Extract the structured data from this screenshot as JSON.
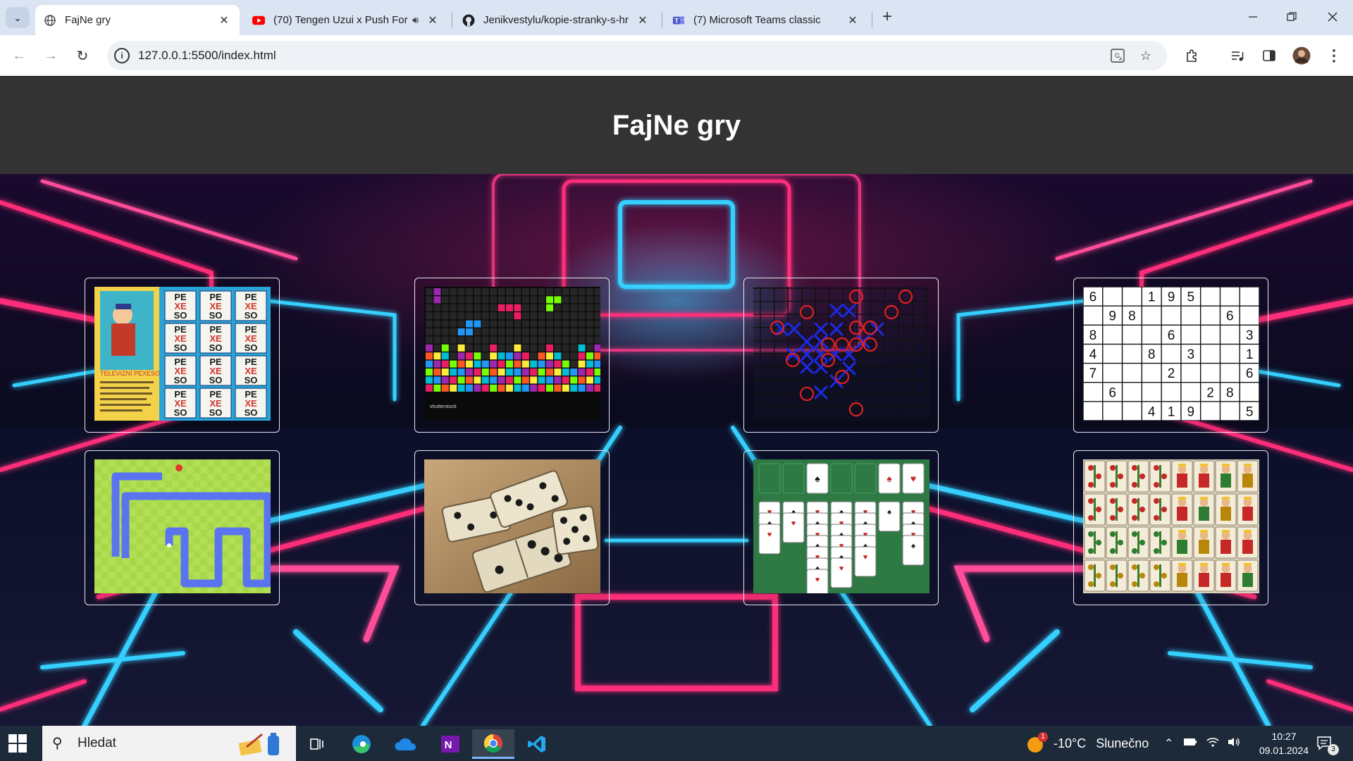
{
  "browser": {
    "tabs": [
      {
        "title": "FajNe gry",
        "active": true,
        "icon": "globe-icon"
      },
      {
        "title": "(70) Tengen Uzui x Push For",
        "active": false,
        "icon": "youtube-icon",
        "audio": true
      },
      {
        "title": "Jenikvestylu/kopie-stranky-s-hr",
        "active": false,
        "icon": "github-icon"
      },
      {
        "title": "(7) Microsoft Teams classic",
        "active": false,
        "icon": "teams-icon"
      }
    ],
    "url": "127.0.0.1:5500/index.html"
  },
  "page": {
    "title": "FajNe gry",
    "games": [
      {
        "name": "pexeso",
        "icon": "pexeso-thumbnail"
      },
      {
        "name": "tetris",
        "icon": "tetris-thumbnail"
      },
      {
        "name": "piskvorky",
        "icon": "tic-tac-toe-thumbnail"
      },
      {
        "name": "sudoku",
        "icon": "sudoku-thumbnail"
      },
      {
        "name": "snake",
        "icon": "snake-thumbnail"
      },
      {
        "name": "domino",
        "icon": "domino-thumbnail"
      },
      {
        "name": "solitaire",
        "icon": "solitaire-thumbnail"
      },
      {
        "name": "mariase",
        "icon": "card-deck-thumbnail"
      }
    ],
    "sudoku": [
      [
        "6",
        "",
        "",
        "1",
        "9",
        "5",
        "",
        "",
        ""
      ],
      [
        "",
        "9",
        "8",
        "",
        "",
        "",
        "",
        "6",
        ""
      ],
      [
        "8",
        "",
        "",
        "",
        "6",
        "",
        "",
        "",
        "3"
      ],
      [
        "4",
        "",
        "",
        "8",
        "",
        "3",
        "",
        "",
        "1"
      ],
      [
        "7",
        "",
        "",
        "",
        "2",
        "",
        "",
        "",
        "6"
      ],
      [
        "",
        "6",
        "",
        "",
        "",
        "",
        "2",
        "8",
        ""
      ],
      [
        "",
        "",
        "",
        "4",
        "1",
        "9",
        "",
        "",
        "5"
      ]
    ],
    "pexeso_caption": "TELEVIZNÍ PEXESO",
    "pexeso_tile": [
      "PE",
      "XE",
      "SO"
    ],
    "tetris_watermark": "shutterstock"
  },
  "taskbar": {
    "search_label": "Hledat",
    "weather_temp": "-10°C",
    "weather_text": "Slunečno",
    "time": "10:27",
    "date": "09.01.2024",
    "notifications": "3",
    "weather_badge": "1"
  },
  "colors": {
    "header_bg": "#333333",
    "tab_strip": "#dbe4f3",
    "taskbar": "#1c2a3a"
  }
}
